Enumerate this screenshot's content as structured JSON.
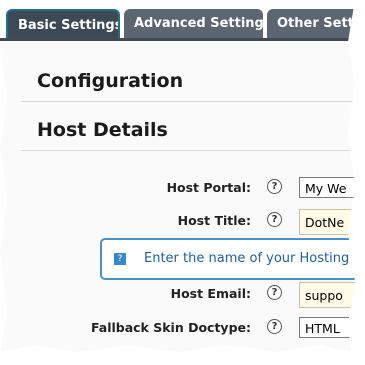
{
  "tabs": [
    {
      "label": "Basic Settings",
      "active": true
    },
    {
      "label": "Advanced Settings",
      "active": false
    },
    {
      "label": "Other Setti",
      "active": false
    }
  ],
  "sections": {
    "configuration": "Configuration",
    "host_details": "Host Details"
  },
  "fields": {
    "host_portal": {
      "label": "Host Portal:",
      "value": "My We"
    },
    "host_title": {
      "label": "Host Title:",
      "value": "DotNe"
    },
    "host_email": {
      "label": "Host Email:",
      "value": "suppo"
    },
    "fallback_skin_doctype": {
      "label": "Fallback Skin Doctype:",
      "value": "HTML"
    }
  },
  "tooltip": {
    "text": "Enter the name of your Hosting"
  },
  "colors": {
    "tab_bg": "#5c6670",
    "tab_active_bg": "#3d4a55",
    "tip_border": "#4a90c8",
    "tip_text": "#1f5f9a",
    "field_yellow": "#fffbe6"
  },
  "icons": {
    "help": "help-circle-icon",
    "info": "info-icon"
  }
}
